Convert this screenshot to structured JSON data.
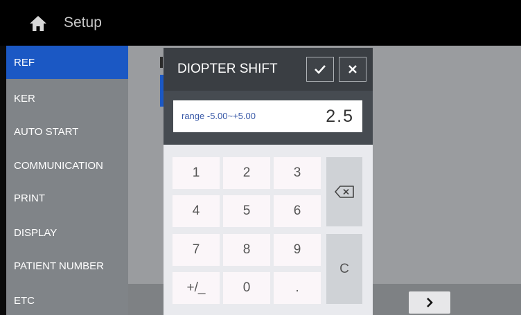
{
  "topbar": {
    "title": "Setup",
    "home_icon": "home-icon"
  },
  "sidebar": {
    "items": [
      {
        "label": "REF",
        "active": true
      },
      {
        "label": "KER"
      },
      {
        "label": "AUTO START"
      },
      {
        "label": "COMMUNICATION"
      },
      {
        "label": "PRINT"
      },
      {
        "label": "DISPLAY"
      },
      {
        "label": "PATIENT NUMBER"
      },
      {
        "label": "ETC"
      }
    ]
  },
  "dialog": {
    "title": "DIOPTER SHIFT",
    "confirm_icon": "check-icon",
    "close_icon": "close-icon",
    "range": "range -5.00~+5.00",
    "value": "2.5",
    "keys": {
      "k1": "1",
      "k2": "2",
      "k3": "3",
      "k4": "4",
      "k5": "5",
      "k6": "6",
      "k7": "7",
      "k8": "8",
      "k9": "9",
      "sign": "+/_",
      "k0": "0",
      "dot": ".",
      "clear": "C",
      "backspace_icon": "backspace-icon"
    }
  },
  "footer": {
    "next_icon": "chevron-right-icon"
  },
  "colors": {
    "accent": "#1b58c4",
    "dialog_header": "#3a3e43",
    "sidebar": "#808488"
  }
}
